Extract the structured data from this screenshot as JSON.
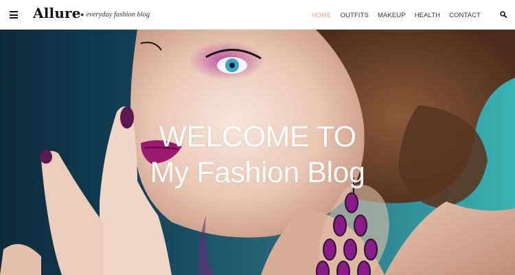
{
  "header": {
    "logo": "Allure",
    "tagline": "everyday fashion blog",
    "nav": [
      {
        "label": "HOME",
        "active": true
      },
      {
        "label": "OUTFITS",
        "active": false
      },
      {
        "label": "MAKEUP",
        "active": false
      },
      {
        "label": "HEALTH",
        "active": false
      },
      {
        "label": "CONTACT",
        "active": false
      }
    ],
    "accent_color": "#f0a08a"
  },
  "hero": {
    "line1": "WELCOME TO",
    "line2": "My Fashion Blog"
  },
  "icons": {
    "menu": "hamburger-icon",
    "search": "search-icon"
  }
}
